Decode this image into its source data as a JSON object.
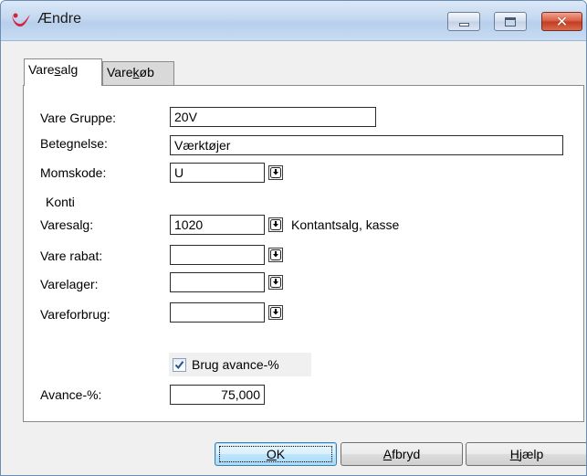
{
  "window": {
    "title": "Ændre",
    "controls": [
      "minimize",
      "maximize",
      "close"
    ],
    "close_glyph": "✕"
  },
  "tabs": [
    {
      "label_pre": "Vare",
      "label_mnemonic": "s",
      "label_post": "alg",
      "active": true
    },
    {
      "label_pre": "Vare",
      "label_mnemonic": "k",
      "label_post": "øb",
      "active": false
    }
  ],
  "general": {
    "vare_gruppe_label": "Vare Gruppe:",
    "vare_gruppe_value": "20V",
    "betegnelse_label": "Betegnelse:",
    "betegnelse_value": "Værktøjer",
    "momskode_label": "Momskode:",
    "momskode_value": "U"
  },
  "konti": {
    "caption": "Konti",
    "varesalg_label": "Varesalg:",
    "varesalg_value": "1020",
    "varesalg_description": "Kontantsalg,  kasse",
    "vare_rabat_label": "Vare rabat:",
    "vare_rabat_value": "",
    "varelager_label": "Varelager:",
    "varelager_value": "",
    "vareforbrug_label": "Vareforbrug:",
    "vareforbrug_value": ""
  },
  "avance": {
    "checkbox_label": "Brug avance-%",
    "checkbox_checked": true,
    "avance_label": "Avance-%:",
    "avance_value": "75,000"
  },
  "buttons": {
    "ok_mnemonic": "O",
    "ok_rest": "K",
    "cancel_mnemonic": "A",
    "cancel_rest": "fbryd",
    "help_mnemonic": "H",
    "help_rest": "jælp"
  },
  "colors": {
    "title_bar": "#c4d8ef",
    "close_button": "#c23b20",
    "ok_button": "#bee6fd",
    "app_icon": "#d6223f"
  }
}
